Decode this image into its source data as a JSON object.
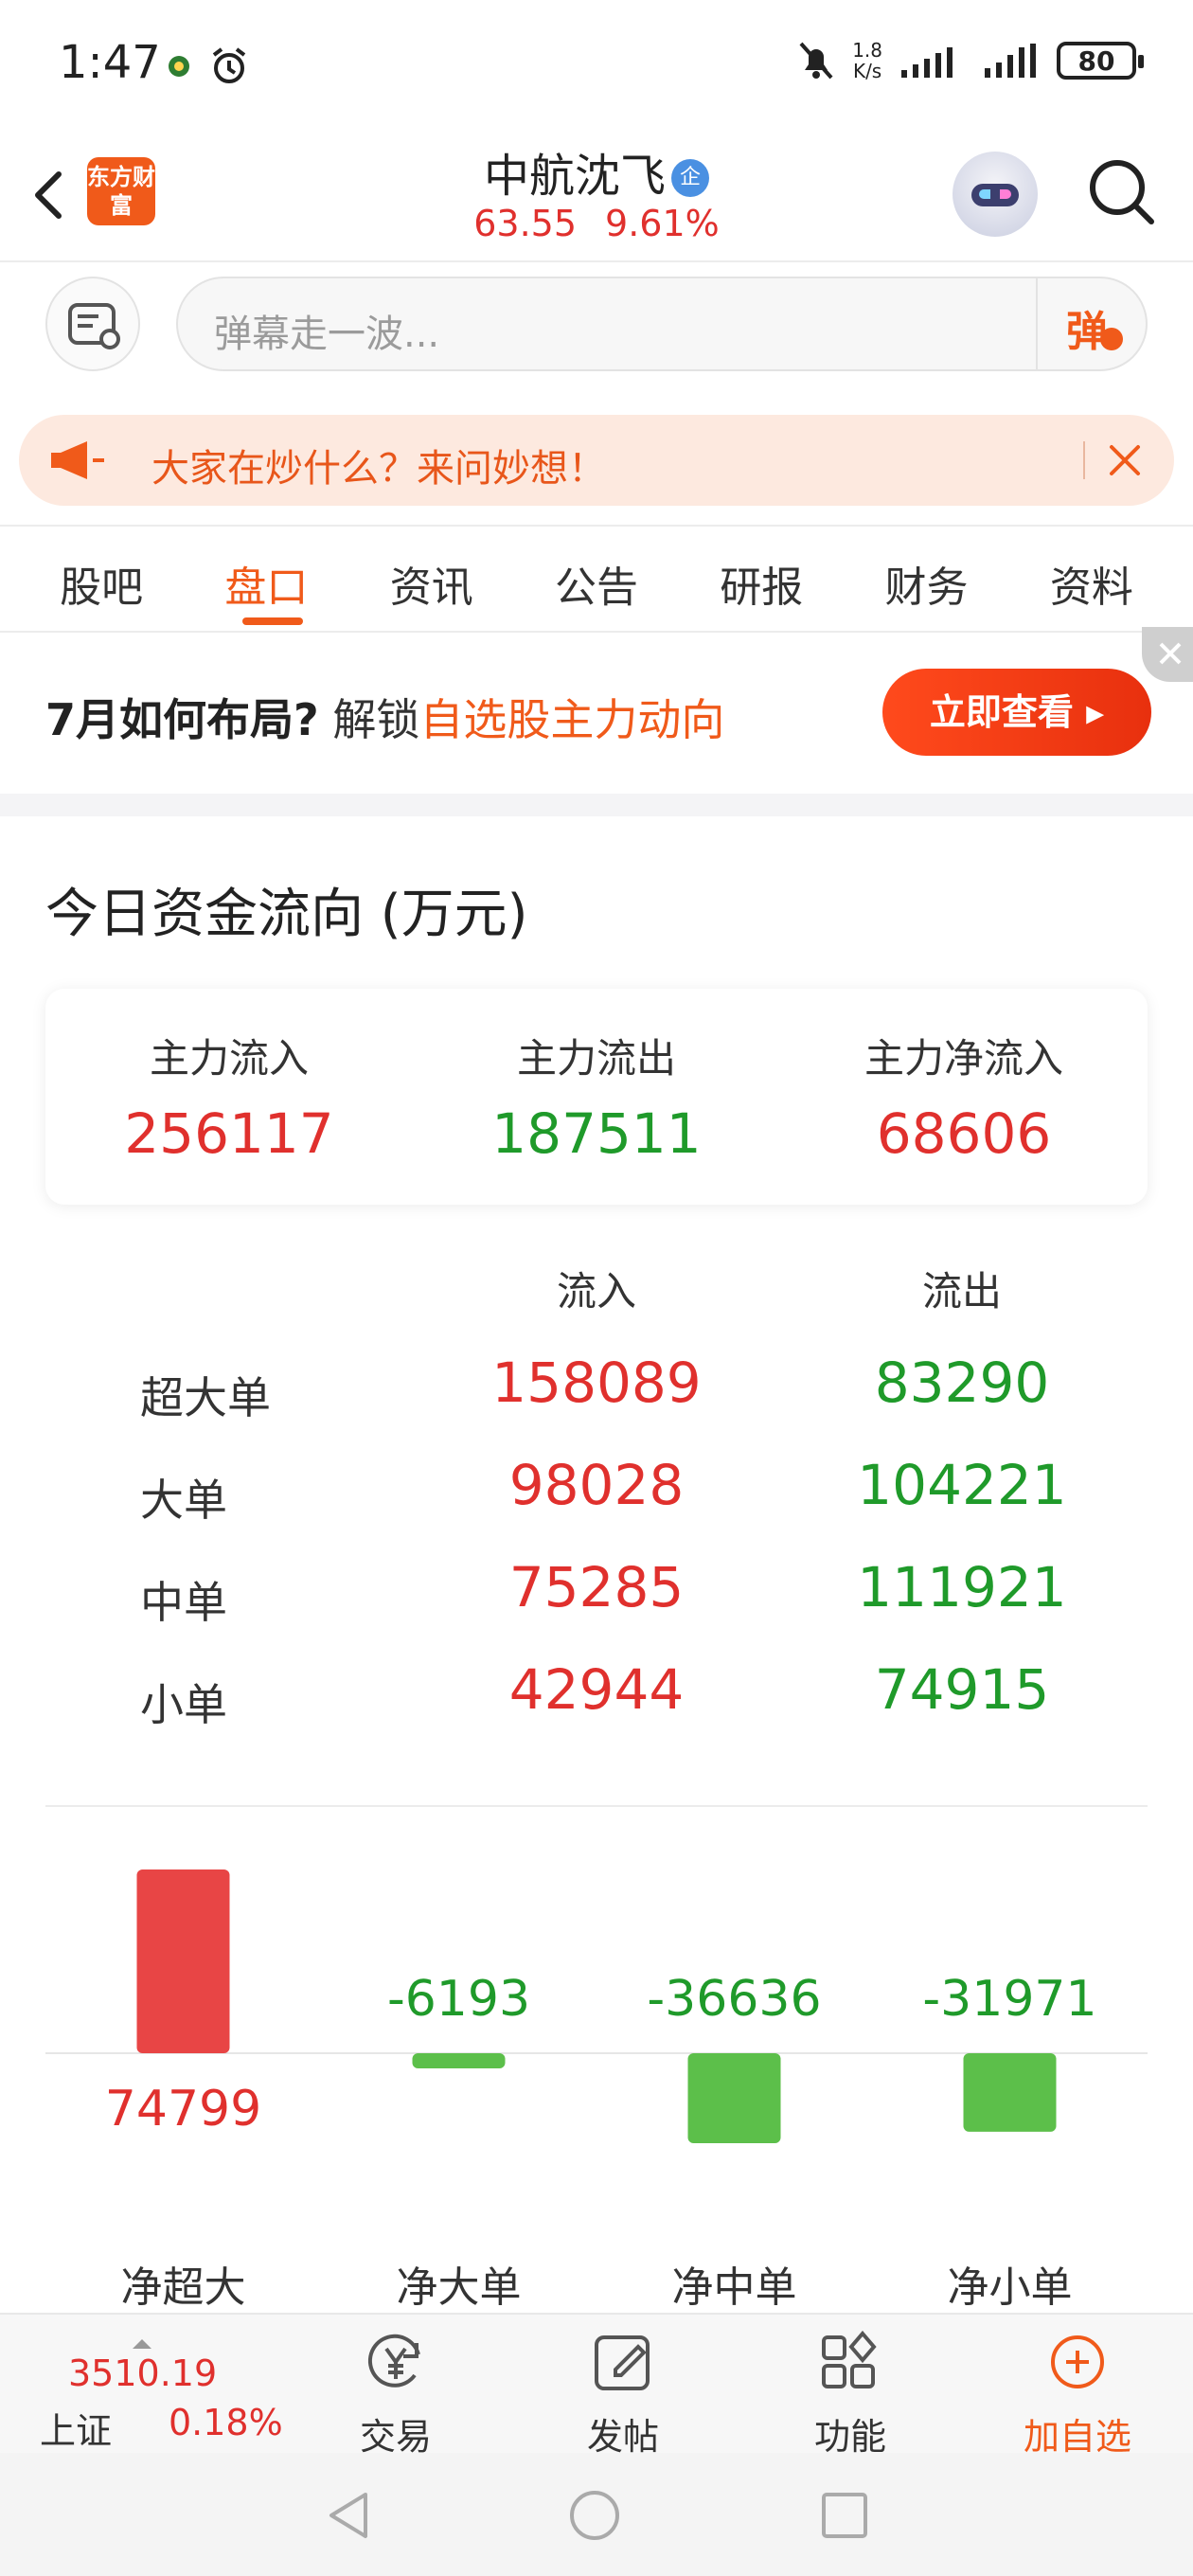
{
  "status_bar": {
    "time": "1:47",
    "net_speed_value": "1.8",
    "net_speed_unit": "K/s",
    "battery": "80"
  },
  "header": {
    "brand_logo": "东方财富",
    "stock_name": "中航沈飞",
    "verify_badge": "企",
    "price": "63.55",
    "change_pct": "9.61%"
  },
  "danmaku": {
    "placeholder": "弹幕走一波...",
    "send_label": "弹"
  },
  "notice": {
    "text": "大家在炒什么？来问妙想！"
  },
  "tabs": [
    {
      "label": "股吧",
      "active": false
    },
    {
      "label": "盘口",
      "active": true
    },
    {
      "label": "资讯",
      "active": false
    },
    {
      "label": "公告",
      "active": false
    },
    {
      "label": "研报",
      "active": false
    },
    {
      "label": "财务",
      "active": false
    },
    {
      "label": "资料",
      "active": false
    }
  ],
  "ad": {
    "bold_text": "7月如何布局?",
    "normal_text": "解锁",
    "highlight_text": "自选股主力动向",
    "button": "立即查看 ▸"
  },
  "capital_flow": {
    "title": "今日资金流向 (万元)",
    "summary": [
      {
        "label": "主力流入",
        "value": "256117",
        "color": "red"
      },
      {
        "label": "主力流出",
        "value": "187511",
        "color": "green"
      },
      {
        "label": "主力净流入",
        "value": "68606",
        "color": "red"
      }
    ],
    "table_headers": {
      "inflow": "流入",
      "outflow": "流出"
    },
    "rows": [
      {
        "label": "超大单",
        "inflow": "158089",
        "outflow": "83290"
      },
      {
        "label": "大单",
        "inflow": "98028",
        "outflow": "104221"
      },
      {
        "label": "中单",
        "inflow": "75285",
        "outflow": "111921"
      },
      {
        "label": "小单",
        "inflow": "42944",
        "outflow": "74915"
      }
    ]
  },
  "chart_data": {
    "type": "bar",
    "categories": [
      "净超大",
      "净大单",
      "净中单",
      "净小单"
    ],
    "values": [
      74799,
      -6193,
      -36636,
      -31971
    ],
    "value_labels": [
      "74799",
      "-6193",
      "-36636",
      "-31971"
    ],
    "colors": {
      "positive": "#e84545",
      "negative": "#5cbf4a"
    },
    "title": "",
    "xlabel": "",
    "ylabel": ""
  },
  "bottom_nav": {
    "index_value": "3510.19",
    "index_name": "上证",
    "index_change": "0.18%",
    "items": [
      {
        "label": "交易",
        "icon": "yen-exchange-icon"
      },
      {
        "label": "发帖",
        "icon": "edit-post-icon"
      },
      {
        "label": "功能",
        "icon": "grid-icon"
      },
      {
        "label": "加自选",
        "icon": "plus-circle-icon"
      }
    ]
  },
  "colors": {
    "accent": "#f05a1a",
    "up": "#e0302d",
    "down": "#1f9a2a"
  }
}
